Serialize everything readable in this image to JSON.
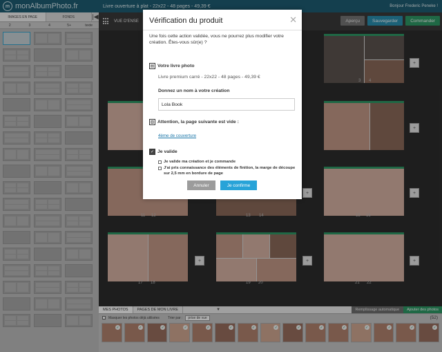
{
  "topbar": {
    "brand": "monAlbumPhoto.fr",
    "book_title": "Livre ouverture à plat - 22x22 - 48 pages - 49,39 €",
    "greeting": "Bonjour Frederic Peneke !"
  },
  "left_panel": {
    "tabs": [
      "IMAGES EN PAGE",
      "FONDS"
    ],
    "collapse": "|◀",
    "filters": [
      "2",
      "3",
      "4",
      "5+",
      "texte"
    ]
  },
  "main_header": {
    "view_label": "VUE D'ENSE",
    "preview": "Aperçu",
    "save": "Sauvegarder",
    "order": "Commander"
  },
  "page_numbers": {
    "p1": "3",
    "p2": "4",
    "p3": "11",
    "p4": "12",
    "p5": "13",
    "p6": "14",
    "p7": "15",
    "p8": "16",
    "p9": "17",
    "p10": "18",
    "p11": "19",
    "p12": "20",
    "p13": "21",
    "p14": "22"
  },
  "bottom": {
    "tab_photos": "MES PHOTOS",
    "tab_pages": "PAGES DE MON LIVRE",
    "arrow": "▼",
    "auto_fill": "Remplissage automatique",
    "add_photos": "Ajouter des photos",
    "hide_used": "Masquer les photos déjà utilisées",
    "sort_label": "Trier par :",
    "sort_value": "prise de vue",
    "count": "(52)"
  },
  "modal": {
    "title": "Vérification du produit",
    "close": "✕",
    "intro": "Une fois cette action validée, vous ne pourrez plus modifier votre création. Êtes-vous sûr(e) ?",
    "book_section": "Votre livre photo",
    "product": "Livre premium carré - 22x22 - 48 pages - 49,39 €",
    "name_label": "Donnez un nom à votre création",
    "name_value": "Lola Book",
    "warning": "Attention, la page suivante est vide :",
    "cover_link": "4ème de couverture",
    "validate_section": "Je valide",
    "check1": "Je valide ma création et je commande",
    "check2": "J'ai pris connaissance des éléments de finition, la marge de découpe sur 2,5 mm en bordure de page",
    "cancel": "Annuler",
    "confirm": "Je confirme"
  }
}
